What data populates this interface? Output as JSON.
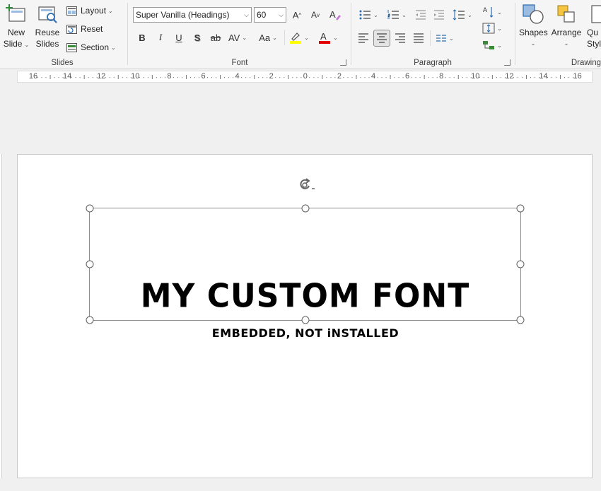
{
  "ribbon": {
    "slides": {
      "label": "Slides",
      "new_slide_line1": "New",
      "new_slide_line2": "Slide",
      "reuse_line1": "Reuse",
      "reuse_line2": "Slides",
      "layout": "Layout",
      "reset": "Reset",
      "section": "Section"
    },
    "font": {
      "label": "Font",
      "font_name": "Super Vanilla (Headings)",
      "font_size": "60",
      "bold": "B",
      "italic": "I",
      "underline": "U",
      "shadow": "S",
      "strike": "ab",
      "spacing": "AV",
      "case": "Aa",
      "grow": "A",
      "shrink": "A",
      "font_color": "A",
      "highlight_color": "#ffff00",
      "font_color_value": "#e00000"
    },
    "paragraph": {
      "label": "Paragraph"
    },
    "drawing": {
      "label": "Drawing",
      "shapes": "Shapes",
      "arrange": "Arrange",
      "quick_styles_line1": "Qu",
      "quick_styles_line2": "Style"
    }
  },
  "ruler": {
    "labels": [
      "16",
      "14",
      "12",
      "10",
      "8",
      "6",
      "4",
      "2",
      "0",
      "2",
      "4",
      "6",
      "8",
      "10",
      "12",
      "14",
      "16"
    ]
  },
  "slide": {
    "title": "MY CUSTOM FONT",
    "subtitle": "EMBEDDED, NOT iNSTALLED"
  },
  "colors": {
    "accent_blue": "#2b6cb0",
    "ribbon_bg": "#f5f5f5"
  }
}
